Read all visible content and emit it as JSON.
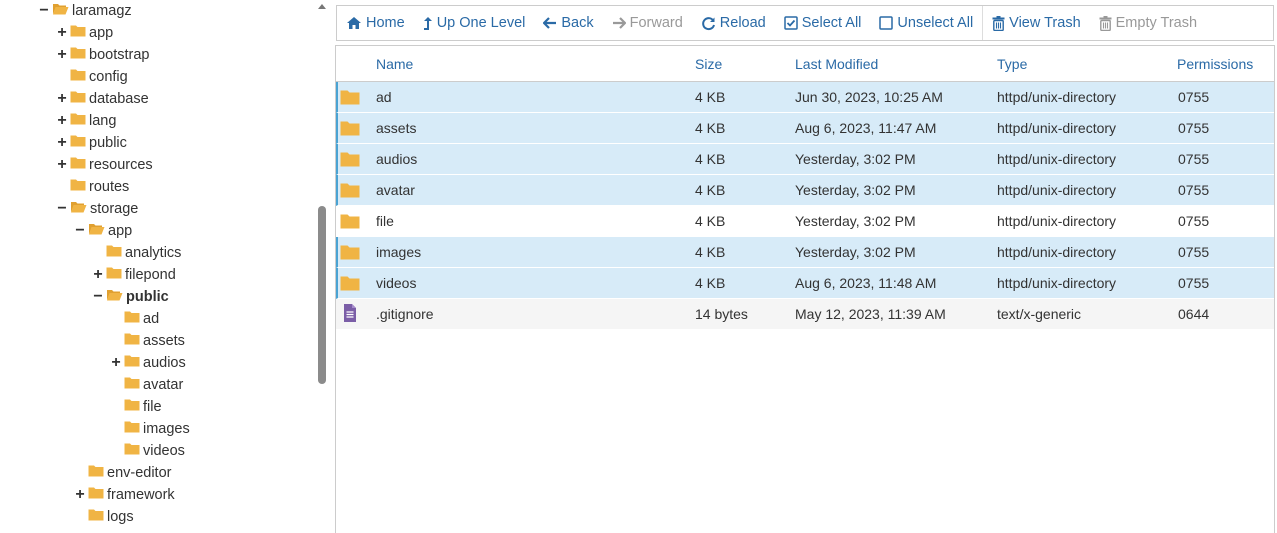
{
  "tree": [
    {
      "label": "laramagz",
      "toggle": "−",
      "open": true,
      "indent": 0,
      "bold": false
    },
    {
      "label": "app",
      "toggle": "+",
      "open": false,
      "indent": 1,
      "bold": false
    },
    {
      "label": "bootstrap",
      "toggle": "+",
      "open": false,
      "indent": 1,
      "bold": false
    },
    {
      "label": "config",
      "toggle": "",
      "open": false,
      "indent": 1,
      "bold": false
    },
    {
      "label": "database",
      "toggle": "+",
      "open": false,
      "indent": 1,
      "bold": false
    },
    {
      "label": "lang",
      "toggle": "+",
      "open": false,
      "indent": 1,
      "bold": false
    },
    {
      "label": "public",
      "toggle": "+",
      "open": false,
      "indent": 1,
      "bold": false
    },
    {
      "label": "resources",
      "toggle": "+",
      "open": false,
      "indent": 1,
      "bold": false
    },
    {
      "label": "routes",
      "toggle": "",
      "open": false,
      "indent": 1,
      "bold": false
    },
    {
      "label": "storage",
      "toggle": "−",
      "open": true,
      "indent": 1,
      "bold": false
    },
    {
      "label": "app",
      "toggle": "−",
      "open": true,
      "indent": 2,
      "bold": false
    },
    {
      "label": "analytics",
      "toggle": "",
      "open": false,
      "indent": 3,
      "bold": false
    },
    {
      "label": "filepond",
      "toggle": "+",
      "open": false,
      "indent": 3,
      "bold": false
    },
    {
      "label": "public",
      "toggle": "−",
      "open": true,
      "indent": 3,
      "bold": true
    },
    {
      "label": "ad",
      "toggle": "",
      "open": false,
      "indent": 4,
      "bold": false
    },
    {
      "label": "assets",
      "toggle": "",
      "open": false,
      "indent": 4,
      "bold": false
    },
    {
      "label": "audios",
      "toggle": "+",
      "open": false,
      "indent": 4,
      "bold": false
    },
    {
      "label": "avatar",
      "toggle": "",
      "open": false,
      "indent": 4,
      "bold": false
    },
    {
      "label": "file",
      "toggle": "",
      "open": false,
      "indent": 4,
      "bold": false
    },
    {
      "label": "images",
      "toggle": "",
      "open": false,
      "indent": 4,
      "bold": false
    },
    {
      "label": "videos",
      "toggle": "",
      "open": false,
      "indent": 4,
      "bold": false
    },
    {
      "label": "env-editor",
      "toggle": "",
      "open": false,
      "indent": 2,
      "bold": false
    },
    {
      "label": "framework",
      "toggle": "+",
      "open": false,
      "indent": 2,
      "bold": false
    },
    {
      "label": "logs",
      "toggle": "",
      "open": false,
      "indent": 2,
      "bold": false
    }
  ],
  "toolbar": {
    "home": "Home",
    "up_one_level": "Up One Level",
    "back": "Back",
    "forward": "Forward",
    "reload": "Reload",
    "select_all": "Select All",
    "unselect_all": "Unselect All",
    "view_trash": "View Trash",
    "empty_trash": "Empty Trash"
  },
  "columns": {
    "name": "Name",
    "size": "Size",
    "last_modified": "Last Modified",
    "type": "Type",
    "permissions": "Permissions"
  },
  "files": [
    {
      "icon": "folder-icon",
      "name": "ad",
      "size": "4 KB",
      "modified": "Jun 30, 2023, 10:25 AM",
      "type": "httpd/unix-directory",
      "perms": "0755",
      "selected": true
    },
    {
      "icon": "folder-icon",
      "name": "assets",
      "size": "4 KB",
      "modified": "Aug 6, 2023, 11:47 AM",
      "type": "httpd/unix-directory",
      "perms": "0755",
      "selected": true
    },
    {
      "icon": "folder-icon",
      "name": "audios",
      "size": "4 KB",
      "modified": "Yesterday, 3:02 PM",
      "type": "httpd/unix-directory",
      "perms": "0755",
      "selected": true
    },
    {
      "icon": "folder-icon",
      "name": "avatar",
      "size": "4 KB",
      "modified": "Yesterday, 3:02 PM",
      "type": "httpd/unix-directory",
      "perms": "0755",
      "selected": true
    },
    {
      "icon": "folder-icon",
      "name": "file",
      "size": "4 KB",
      "modified": "Yesterday, 3:02 PM",
      "type": "httpd/unix-directory",
      "perms": "0755",
      "selected": false
    },
    {
      "icon": "folder-icon",
      "name": "images",
      "size": "4 KB",
      "modified": "Yesterday, 3:02 PM",
      "type": "httpd/unix-directory",
      "perms": "0755",
      "selected": true
    },
    {
      "icon": "folder-icon",
      "name": "videos",
      "size": "4 KB",
      "modified": "Aug 6, 2023, 11:48 AM",
      "type": "httpd/unix-directory",
      "perms": "0755",
      "selected": true
    },
    {
      "icon": "text-file-icon",
      "name": ".gitignore",
      "size": "14 bytes",
      "modified": "May 12, 2023, 11:39 AM",
      "type": "text/x-generic",
      "perms": "0644",
      "selected": false
    }
  ],
  "colors": {
    "link": "#2a6aa6",
    "folder": "#f0b444",
    "selected_row": "#d7ebf8",
    "selected_border": "#4aa3d3",
    "text_file": "#7b5ea7"
  }
}
